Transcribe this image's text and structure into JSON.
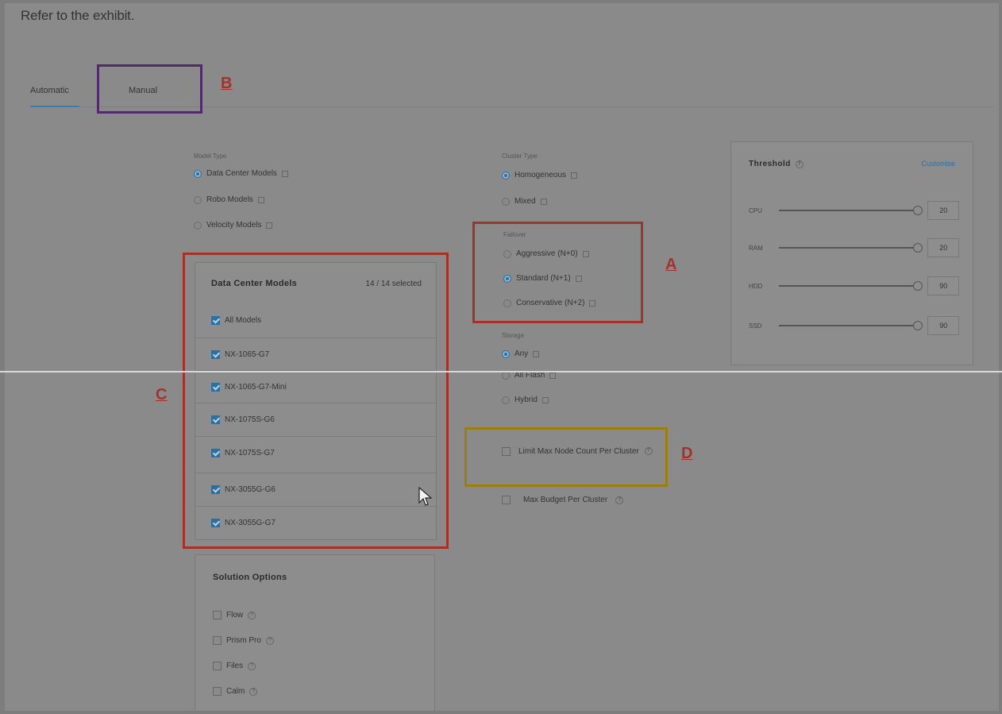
{
  "exhibit_title": "Refer to the exhibit.",
  "tabs": {
    "automatic": "Automatic",
    "manual": "Manual"
  },
  "annotations": {
    "a": "A",
    "b": "B",
    "c": "C",
    "d": "D"
  },
  "model_type": {
    "label": "Model Type",
    "options": [
      "Data Center Models",
      "Robo Models",
      "Velocity Models"
    ],
    "selected": "Data Center Models"
  },
  "cluster_type": {
    "label": "Cluster Type",
    "options": [
      "Homogeneous",
      "Mixed"
    ],
    "selected": "Homogeneous"
  },
  "failover": {
    "label": "Failover",
    "options": [
      "Aggressive (N+0)",
      "Standard (N+1)",
      "Conservative (N+2)"
    ],
    "selected": "Standard (N+1)"
  },
  "storage": {
    "label": "Storage",
    "options": [
      "Any",
      "All Flash",
      "Hybrid"
    ],
    "selected": "Any"
  },
  "limits": {
    "max_node": "Limit Max Node Count Per Cluster",
    "max_budget": "Max Budget Per Cluster"
  },
  "models_panel": {
    "title": "Data Center Models",
    "count": "14 / 14 selected",
    "items": [
      "All Models",
      "NX-1065-G7",
      "NX-1065-G7-Mini",
      "NX-1075S-G6",
      "NX-1075S-G7",
      "NX-3055G-G6",
      "NX-3055G-G7"
    ]
  },
  "solution_options": {
    "title": "Solution Options",
    "items": [
      "Flow",
      "Prism Pro",
      "Files",
      "Calm"
    ]
  },
  "threshold": {
    "title": "Threshold",
    "customise": "Customise",
    "rows": [
      {
        "label": "CPU",
        "value": "20"
      },
      {
        "label": "RAM",
        "value": "20"
      },
      {
        "label": "HDD",
        "value": "90"
      },
      {
        "label": "SSD",
        "value": "90"
      }
    ]
  },
  "colors": {
    "accent": "#2f6f9e",
    "annotation_red": "#a3322b",
    "annotation_purple": "#4f2b6b",
    "annotation_yellow": "#9a7e10"
  }
}
